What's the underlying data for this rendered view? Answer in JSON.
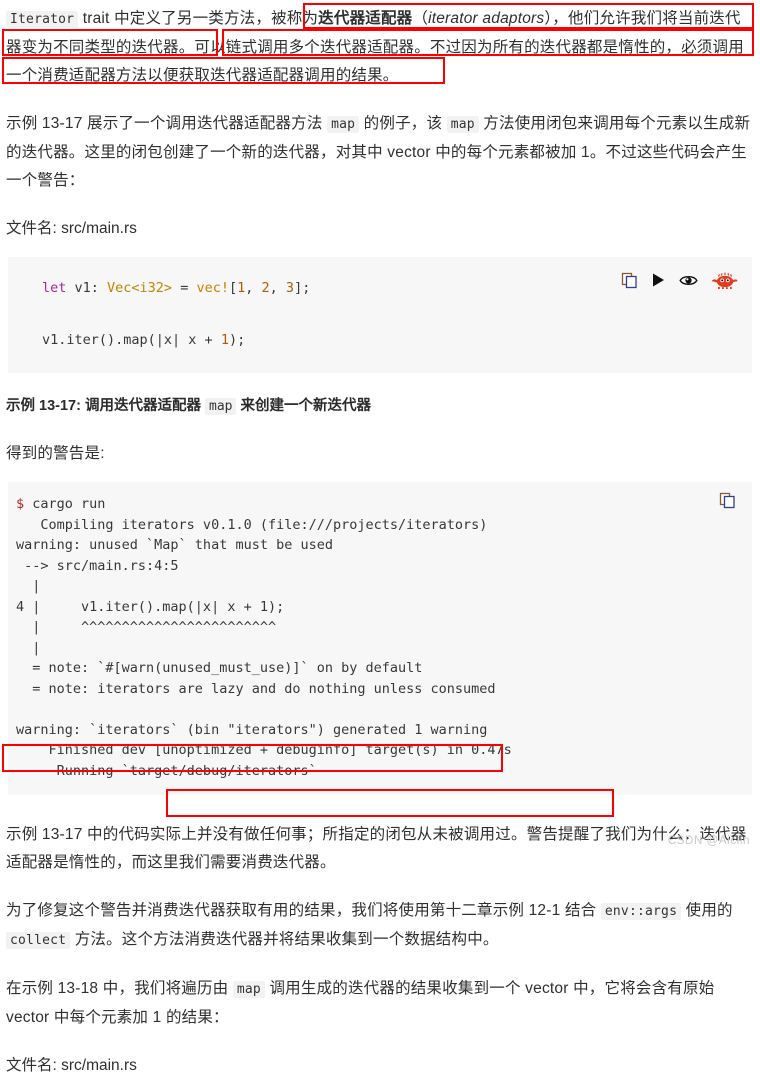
{
  "document": {
    "watermark": "CSDN @Aiclin",
    "accent_red": "#ff0000",
    "code_bg": "#f7f7f8"
  },
  "paragraphs": {
    "intro": {
      "seg1": "Iterator",
      "seg2": " trait 中定义了另一类方法，被称为",
      "seg3_marked": "迭代器适配器",
      "seg4": "（",
      "seg5_italic": "iterator adaptors",
      "seg6": "），他们允许我们将当前迭代器变为不同类型的迭代器。",
      "seg7_marked": "可以链式调用多个迭代器适配器。不过因为所有的迭代器都是惰性的，必须调用一个消费适配器方法以便获取迭代器适配器调用的结果。"
    },
    "p2": {
      "a": "示例 13-17 展示了一个调用迭代器适配器方法 ",
      "code1": "map",
      "b": " 的例子，该 ",
      "code2": "map",
      "c": " 方法使用闭包来调用每个元素以生成新的迭代器。这里的闭包创建了一个新的迭代器，对其中 vector 中的每个元素都被加 1。不过这些代码会产生一个警告："
    },
    "filename_1": "文件名: src/main.rs",
    "caption_1": {
      "a": "示例 13-17: 调用迭代器适配器 ",
      "code": "map",
      "b": " 来创建一个新迭代器"
    },
    "warning_lead": "得到的警告是:",
    "p3": "示例 13-17 中的代码实际上并没有做任何事；所指定的闭包从未被调用过。警告提醒了我们为什么：迭代器适配器是惰性的，而这里我们需要消费迭代器。",
    "p4": {
      "a": "为了修复这个警告并消费迭代器获取有用的结果，我们将使用第十二章示例 12-1 结合 ",
      "code1": "env::args",
      "b": " 使用的 ",
      "code2": "collect",
      "c": " 方法。这个方法消费迭代器并将结果收集到一个数据结构中。"
    },
    "p5": {
      "a": "在示例 13-18 中，我们",
      "marked_a": "将遍历由 ",
      "marked_code": "map",
      "marked_b": " 调用生成的迭代器的结果收集到一个 vector 中，",
      "b": "它将会含有原始 vector 中每个元素加 1 的结果："
    },
    "filename_2": "文件名: src/main.rs"
  },
  "code_block": {
    "tools": [
      {
        "name": "copy-icon",
        "title": "复制"
      },
      {
        "name": "play-icon",
        "title": "运行"
      },
      {
        "name": "eye-icon",
        "title": "显示隐藏"
      },
      {
        "name": "ferris-crab-icon",
        "title": "Ferris"
      }
    ],
    "lines": [
      {
        "parts": [
          {
            "cls": "k-let",
            "t": "let"
          },
          {
            "cls": "k-plain",
            "t": " v1: "
          },
          {
            "cls": "k-type",
            "t": "Vec<i32>"
          },
          {
            "cls": "k-plain",
            "t": " = "
          },
          {
            "cls": "k-macro",
            "t": "vec!"
          },
          {
            "cls": "k-plain",
            "t": "["
          },
          {
            "cls": "k-num",
            "t": "1"
          },
          {
            "cls": "k-plain",
            "t": ", "
          },
          {
            "cls": "k-num",
            "t": "2"
          },
          {
            "cls": "k-plain",
            "t": ", "
          },
          {
            "cls": "k-num",
            "t": "3"
          },
          {
            "cls": "k-plain",
            "t": "];"
          }
        ]
      },
      {
        "parts": []
      },
      {
        "parts": [
          {
            "cls": "k-plain",
            "t": "v1.iter().map(|x| x + "
          },
          {
            "cls": "k-num",
            "t": "1"
          },
          {
            "cls": "k-plain",
            "t": ");"
          }
        ]
      }
    ]
  },
  "terminal_block": {
    "tool": {
      "name": "copy-icon",
      "title": "复制"
    },
    "prompt": "$",
    "command": " cargo run",
    "output": "   Compiling iterators v0.1.0 (file:///projects/iterators)\nwarning: unused `Map` that must be used\n --> src/main.rs:4:5\n  |\n4 |     v1.iter().map(|x| x + 1);\n  |     ^^^^^^^^^^^^^^^^^^^^^^^^\n  |\n  = note: `#[warn(unused_must_use)]` on by default\n  = note: iterators are lazy and do nothing unless consumed\n\nwarning: `iterators` (bin \"iterators\") generated 1 warning\n    Finished dev [unoptimized + debuginfo] target(s) in 0.47s\n     Running `target/debug/iterators`"
  }
}
